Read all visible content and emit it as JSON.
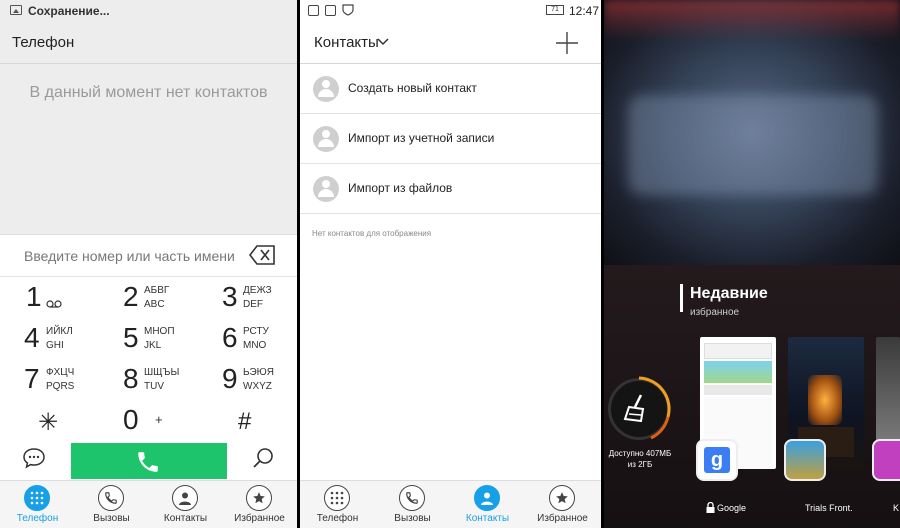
{
  "phone": {
    "status_text": "Сохранение...",
    "title": "Телефон",
    "empty_message": "В данный момент нет контактов",
    "dial_placeholder": "Введите номер или часть имени",
    "keys": [
      {
        "digit": "1",
        "cyr": "",
        "lat": "",
        "voicemail": true
      },
      {
        "digit": "2",
        "cyr": "АБВГ",
        "lat": "ABC"
      },
      {
        "digit": "3",
        "cyr": "ДЕЖЗ",
        "lat": "DEF"
      },
      {
        "digit": "4",
        "cyr": "ИЙКЛ",
        "lat": "GHI"
      },
      {
        "digit": "5",
        "cyr": "МНОП",
        "lat": "JKL"
      },
      {
        "digit": "6",
        "cyr": "РСТУ",
        "lat": "MNO"
      },
      {
        "digit": "7",
        "cyr": "ФХЦЧ",
        "lat": "PQRS"
      },
      {
        "digit": "8",
        "cyr": "ШЩЪЫ",
        "lat": "TUV"
      },
      {
        "digit": "9",
        "cyr": "ЬЭЮЯ",
        "lat": "WXYZ"
      }
    ],
    "star": "✳",
    "zero": "0",
    "plus": "+",
    "hash": "#",
    "call_color": "#1ec46b"
  },
  "tabs_left": [
    {
      "label": "Телефон",
      "icon": "dialpad-icon",
      "active": true
    },
    {
      "label": "Вызовы",
      "icon": "phone-icon",
      "active": false
    },
    {
      "label": "Контакты",
      "icon": "person-icon",
      "active": false
    },
    {
      "label": "Избранное",
      "icon": "star-icon",
      "active": false
    }
  ],
  "contacts": {
    "battery": "71",
    "time": "12:47",
    "title": "Контакты",
    "rows": [
      {
        "label": "Создать новый контакт"
      },
      {
        "label": "Импорт из учетной записи"
      },
      {
        "label": "Импорт из файлов"
      }
    ],
    "empty_message": "Нет контактов для отображения"
  },
  "tabs_right": [
    {
      "label": "Телефон",
      "icon": "dialpad-icon",
      "active": false
    },
    {
      "label": "Вызовы",
      "icon": "phone-icon",
      "active": false
    },
    {
      "label": "Контакты",
      "icon": "person-icon",
      "active": true
    },
    {
      "label": "Избранное",
      "icon": "star-icon",
      "active": false
    }
  ],
  "recents": {
    "title": "Недавние",
    "subtitle": "избранное",
    "memory_text": "Доступно 407МБ из 2ГБ",
    "apps": [
      {
        "label": "Google",
        "locked": true
      },
      {
        "label": "Trials Front.",
        "locked": false
      },
      {
        "label": "K",
        "locked": false
      }
    ]
  },
  "accent": "#16a0e8"
}
